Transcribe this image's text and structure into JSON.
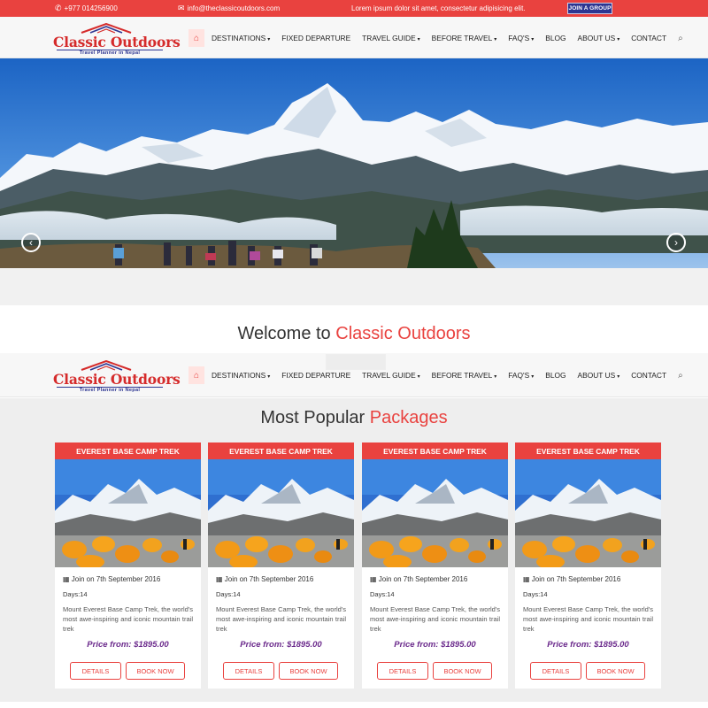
{
  "topbar": {
    "phone": "+977 014256900",
    "email": "info@theclassicoutdoors.com",
    "tagline": "Lorem ipsum dolor sit amet, consectetur adipisicing elit.",
    "join_label": "JOIN A GROUP"
  },
  "brand": {
    "name": "Classic Outdoors",
    "tagline": "Travel Planner in Nepal"
  },
  "nav": {
    "home_icon": "home-icon",
    "items": [
      {
        "label": "Destinations",
        "caret": "▾"
      },
      {
        "label": "Fixed Departure",
        "caret": ""
      },
      {
        "label": "Travel Guide",
        "caret": "▾"
      },
      {
        "label": "Before Travel",
        "caret": "▾"
      },
      {
        "label": "FAQ's",
        "caret": "▾"
      },
      {
        "label": "Blog",
        "caret": ""
      },
      {
        "label": "About Us",
        "caret": "▾"
      },
      {
        "label": "Contact",
        "caret": ""
      }
    ],
    "search_icon": "search-icon"
  },
  "hero": {
    "prev_icon": "chevron-left-icon",
    "next_icon": "chevron-right-icon"
  },
  "welcome": {
    "prefix": "Welcome to",
    "accent": "Classic Outdoors"
  },
  "packages": {
    "title_prefix": "Most Popular",
    "title_accent": "Packages",
    "cards": [
      {
        "title": "Everest Base Camp Trek",
        "date": "Join on 7th September 2016",
        "days": "Days:14",
        "desc": "Mount Everest Base Camp Trek, the world's most awe-inspiring and iconic mountain trail trek",
        "price": "Price from: $1895.00",
        "details_label": "Details",
        "book_label": "Book Now"
      },
      {
        "title": "Everest Base Camp Trek",
        "date": "Join on 7th September 2016",
        "days": "Days:14",
        "desc": "Mount Everest Base Camp Trek, the world's most awe-inspiring and iconic mountain trail trek",
        "price": "Price from: $1895.00",
        "details_label": "Details",
        "book_label": "Book Now"
      },
      {
        "title": "Everest Base Camp Trek",
        "date": "Join on 7th September 2016",
        "days": "Days:14",
        "desc": "Mount Everest Base Camp Trek, the world's most awe-inspiring and iconic mountain trail trek",
        "price": "Price from: $1895.00",
        "details_label": "Details",
        "book_label": "Book Now"
      },
      {
        "title": "Everest Base Camp Trek",
        "date": "Join on 7th September 2016",
        "days": "Days:14",
        "desc": "Mount Everest Base Camp Trek, the world's most awe-inspiring and iconic mountain trail trek",
        "price": "Price from: $1895.00",
        "details_label": "Details",
        "book_label": "Book Now"
      }
    ]
  },
  "colors": {
    "accent": "#e9423f",
    "brand_blue": "#2d3591",
    "price_purple": "#6b2a8c"
  }
}
